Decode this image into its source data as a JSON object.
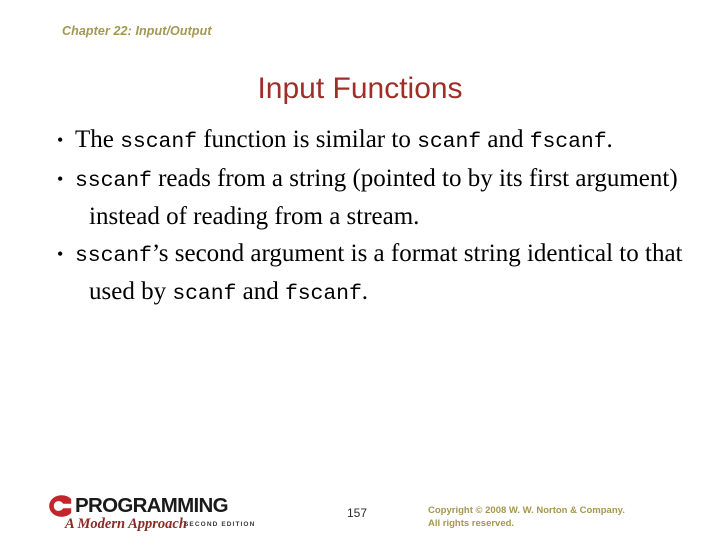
{
  "slide": {
    "chapter_header": "Chapter 22: Input/Output",
    "title": "Input Functions",
    "page_number": "157",
    "colors": {
      "header_olive": "#a39751",
      "title_red": "#9e2f28",
      "logo_red": "#c4252b",
      "body_text": "#000000",
      "background": "#ffffff"
    },
    "bullets": [
      {
        "marker": "•",
        "parts": [
          {
            "text": "The ",
            "style": "normal"
          },
          {
            "text": "sscanf",
            "style": "code"
          },
          {
            "text": " function is similar to ",
            "style": "normal"
          },
          {
            "text": "scanf",
            "style": "code"
          },
          {
            "text": " and ",
            "style": "normal"
          },
          {
            "text": "fscanf",
            "style": "code"
          },
          {
            "text": ".",
            "style": "normal"
          }
        ]
      },
      {
        "marker": "•",
        "parts": [
          {
            "text": "sscanf",
            "style": "code"
          },
          {
            "text": " reads from a string (pointed to by its first argument) instead of reading from a stream.",
            "style": "normal"
          }
        ]
      },
      {
        "marker": "•",
        "parts": [
          {
            "text": "sscanf",
            "style": "code"
          },
          {
            "text": "’s second argument is a format string identical to that used by ",
            "style": "normal"
          },
          {
            "text": "scanf",
            "style": "code"
          },
          {
            "text": " and ",
            "style": "normal"
          },
          {
            "text": "fscanf",
            "style": "code"
          },
          {
            "text": ".",
            "style": "normal"
          }
        ]
      }
    ],
    "footer": {
      "logo_letter": "C",
      "logo_wordmark": "PROGRAMMING",
      "logo_subtitle": "A Modern Approach",
      "logo_edition": "SECOND EDITION",
      "copyright_line1": "Copyright © 2008 W. W. Norton & Company.",
      "copyright_line2": "All rights reserved."
    }
  }
}
